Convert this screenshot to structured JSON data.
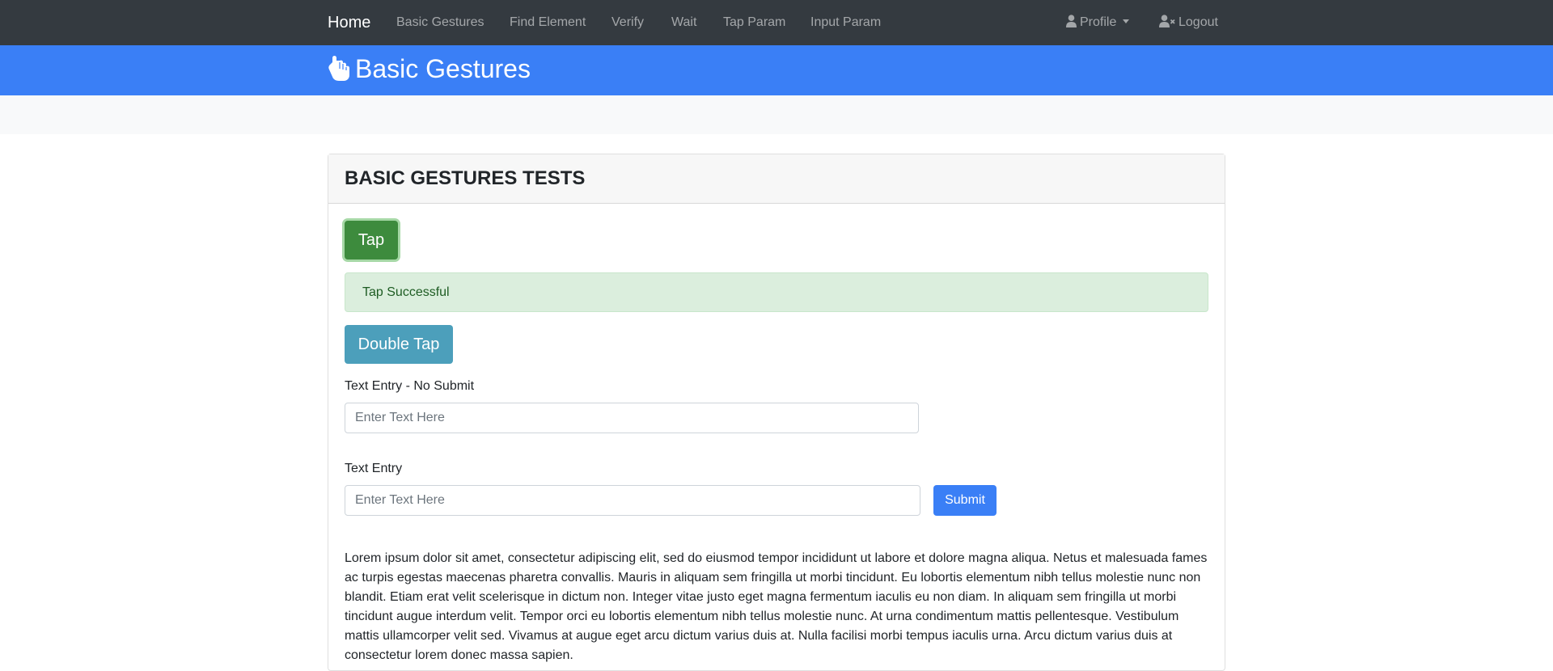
{
  "navbar": {
    "brand": "Home",
    "links": [
      "Basic Gestures",
      "Find Element",
      "Verify",
      "Wait",
      "Tap Param",
      "Input Param"
    ],
    "profile_label": "Profile",
    "logout_label": "Logout"
  },
  "header": {
    "title": "Basic Gestures"
  },
  "card": {
    "title": "BASIC GESTURES TESTS",
    "tap_label": "Tap",
    "alert_text": "Tap Successful",
    "double_tap_label": "Double Tap",
    "text_entry_no_submit_label": "Text Entry - No Submit",
    "text_entry_no_submit_placeholder": "Enter Text Here",
    "text_entry_label": "Text Entry",
    "text_entry_placeholder": "Enter Text Here",
    "submit_label": "Submit",
    "lorem": "Lorem ipsum dolor sit amet, consectetur adipiscing elit, sed do eiusmod tempor incididunt ut labore et dolore magna aliqua. Netus et malesuada fames ac turpis egestas maecenas pharetra convallis. Mauris in aliquam sem fringilla ut morbi tincidunt. Eu lobortis elementum nibh tellus molestie nunc non blandit. Etiam erat velit scelerisque in dictum non. Integer vitae justo eget magna fermentum iaculis eu non diam. In aliquam sem fringilla ut morbi tincidunt augue interdum velit. Tempor orci eu lobortis elementum nibh tellus molestie nunc. At urna condimentum mattis pellentesque. Vestibulum mattis ullamcorper velit sed. Vivamus at augue eget arcu dictum varius duis at. Nulla facilisi morbi tempus iaculis urna. Arcu dictum varius duis at consectetur lorem donec massa sapien."
  },
  "colors": {
    "navbar_bg": "#343a40",
    "header_bg": "#3a7ff6",
    "tap_button": "#3d8b3d",
    "double_tap_button": "#4c9fbb",
    "submit_button": "#3a7ff6",
    "alert_bg": "#dbeedd"
  },
  "icons": {
    "header": "pointing-hand-icon",
    "profile": "user-icon",
    "logout": "user-times-icon",
    "dropdown": "caret-down-icon"
  }
}
